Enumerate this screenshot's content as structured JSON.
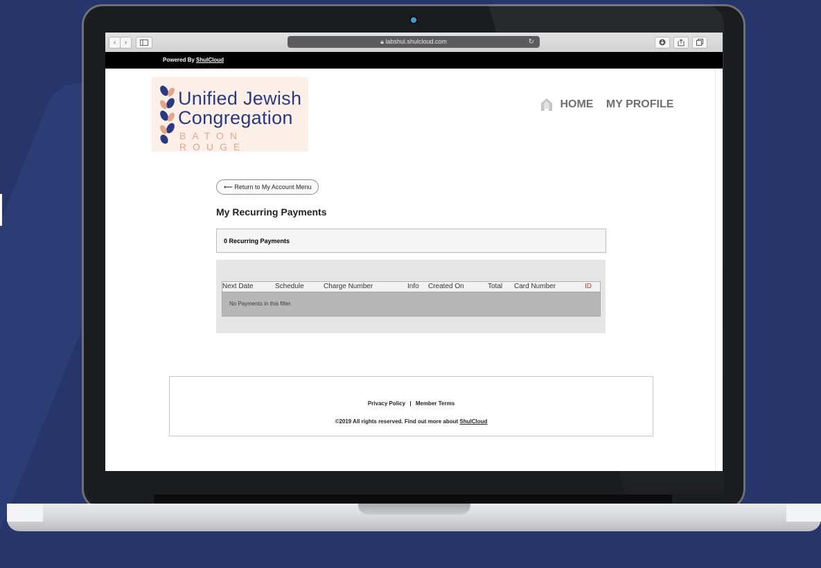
{
  "browser": {
    "url": "labshul.shulcloud.com",
    "back_icon": "chevron-left-icon",
    "forward_icon": "chevron-right-icon",
    "sidebar_icon": "sidebar-icon",
    "download_icon": "download-icon",
    "share_icon": "share-icon",
    "tabs_icon": "tabs-icon"
  },
  "powered_bar": {
    "prefix": "Powered By ",
    "link": "ShulCloud"
  },
  "logo": {
    "line1": "Unified Jewish",
    "line2": "Congregation",
    "line3": "BATON ROUGE",
    "brand_color": "#2a3a80",
    "accent_color": "#e4a58d"
  },
  "nav": {
    "home": "HOME",
    "profile": "MY PROFILE"
  },
  "page": {
    "back_button": "⟵ Return to My Account Menu",
    "title": "My Recurring Payments",
    "count_label": "0 Recurring Payments"
  },
  "table": {
    "columns": [
      "Next Date",
      "Schedule",
      "Charge Number",
      "Info",
      "Created On",
      "Total",
      "Card Number",
      "ID"
    ],
    "empty_message": "No Payments in this filter.",
    "id_color": "#d4302a"
  },
  "footer": {
    "privacy": "Privacy Policy",
    "separator": "|",
    "terms": "Member Terms",
    "copyright": "©2019 All rights reserved. Find out more about ",
    "copyright_link": "ShulCloud"
  }
}
